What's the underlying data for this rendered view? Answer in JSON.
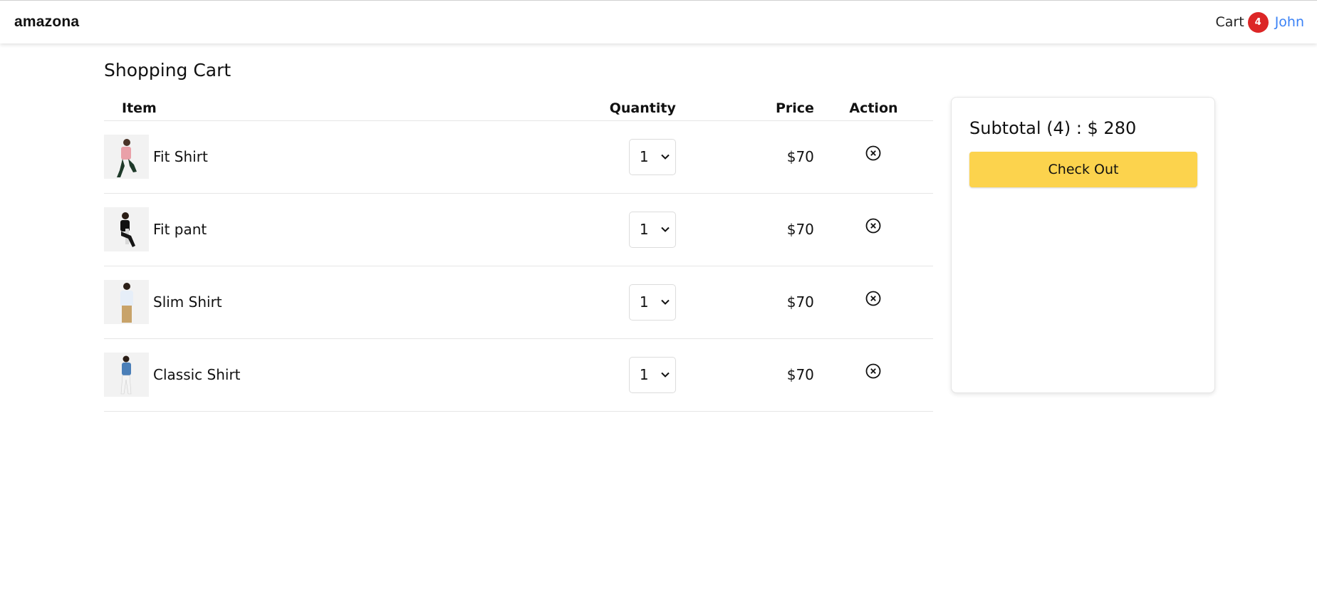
{
  "navbar": {
    "brand": "amazona",
    "cart_label": "Cart",
    "cart_count": "4",
    "user_name": "John",
    "badge_color": "#dc2626",
    "user_link_color": "#3b82f6"
  },
  "page": {
    "title": "Shopping Cart"
  },
  "table": {
    "headers": {
      "item": "Item",
      "quantity": "Quantity",
      "price": "Price",
      "action": "Action"
    },
    "rows": [
      {
        "name": "Fit Shirt",
        "quantity": "1",
        "price": "$70",
        "image": "product-thumbnail-fit-shirt"
      },
      {
        "name": "Fit pant",
        "quantity": "1",
        "price": "$70",
        "image": "product-thumbnail-fit-pant"
      },
      {
        "name": "Slim Shirt",
        "quantity": "1",
        "price": "$70",
        "image": "product-thumbnail-slim-shirt"
      },
      {
        "name": "Classic Shirt",
        "quantity": "1",
        "price": "$70",
        "image": "product-thumbnail-classic-shirt"
      }
    ],
    "remove_icon": "circle-x-icon",
    "qty_icon": "chevron-down-icon"
  },
  "summary": {
    "subtotal": "Subtotal (4) : $ 280",
    "checkout_label": "Check Out",
    "checkout_color": "#fcd34d"
  }
}
